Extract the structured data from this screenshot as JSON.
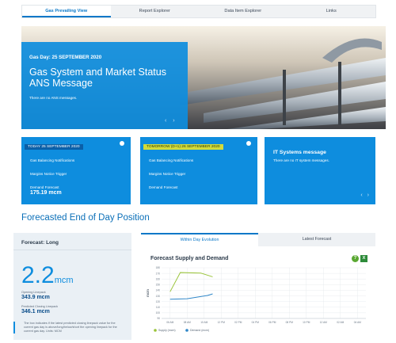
{
  "tabs": [
    {
      "label": "Gas Prevailing View",
      "active": true
    },
    {
      "label": "Report Explorer",
      "active": false
    },
    {
      "label": "Data Item Explorer",
      "active": false
    },
    {
      "label": "Links",
      "active": false
    }
  ],
  "hero": {
    "date": "Gas Day: 25 SEPTEMBER 2020",
    "title_line1": "Gas System and Market Status",
    "title_line2": "ANS Message",
    "subtitle": "There are no ANS messages.",
    "nav": "‹ ›"
  },
  "cards": [
    {
      "header": "TODAY 25 SEPTEMBER 2020",
      "lines": [
        "Gas Balancing Notifications",
        "Margins Notice Trigger",
        "Demand Forecast"
      ],
      "value": "175.19  mcm"
    },
    {
      "header": "TOMORROW (D+1) 26 SEPTEMBER 2020",
      "lines": [
        "Gas Balancing Notifications",
        "Margins Notice Trigger",
        "Demand Forecast"
      ]
    },
    {
      "title": "IT Systems message",
      "subtitle": "There are no IT system messages.",
      "nav": "‹ ›"
    }
  ],
  "section_title": "Forecasted End of Day Position",
  "forecast": {
    "header": "Forecast: Long",
    "big_value": "2.2",
    "big_unit": "mcm",
    "opening_label": "Opening Linepack",
    "opening_value": "343.9 mcm",
    "closing_label": "Predicted Closing Linepack",
    "closing_value": "346.1 mcm",
    "note": "The box indicates if the latest predicted closing linepack value for the current gas day is above/long/below/short the opening linepack for the current gas day. Units: MCM"
  },
  "chart_panel": {
    "tabs": [
      {
        "label": "Within Day Evolution",
        "active": true
      },
      {
        "label": "Latest Forecast",
        "active": false
      }
    ],
    "icons": {
      "help": "help-icon",
      "export": "excel-export-icon"
    }
  },
  "chart_data": {
    "type": "line",
    "title": "Forecast Supply and Demand",
    "ylabel": "mcm",
    "y_ticks": [
      "180",
      "170",
      "160",
      "150",
      "140",
      "130",
      "120",
      "110",
      "100",
      "90"
    ],
    "x_ticks": [
      "06 AM",
      "08 AM",
      "10 AM",
      "12 PM",
      "02 PM",
      "04 PM",
      "06 PM",
      "08 PM",
      "10 PM",
      "12 AM",
      "02 AM",
      "04 AM"
    ],
    "ylim": [
      90,
      185
    ],
    "grid": true,
    "legend_position": "bottom-left",
    "series": [
      {
        "name": "Supply (mcm)",
        "color": "#9ac43a",
        "x": [
          0,
          0.6,
          1.8,
          2.5
        ],
        "values": [
          140,
          176,
          175,
          168
        ]
      },
      {
        "name": "Demand (mcm)",
        "color": "#2e86c8",
        "x": [
          0,
          1.0,
          2.2,
          2.5
        ],
        "values": [
          126,
          127,
          133,
          136
        ]
      }
    ]
  }
}
